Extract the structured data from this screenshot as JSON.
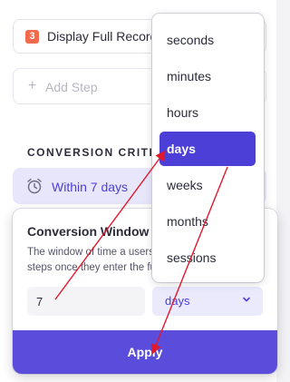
{
  "steps": {
    "step3": {
      "number": "3",
      "label": "Display Full Record"
    },
    "add_step_label": "Add Step",
    "add_step_icon": "plus-icon"
  },
  "conversion": {
    "heading": "CONVERSION CRITERIA",
    "summary_icon": "alarm-clock-icon",
    "summary_label": "Within 7 days"
  },
  "popover": {
    "title": "Conversion Window",
    "description": "The window of time a users has to complete all steps once they enter the funnel",
    "amount_value": "7",
    "unit_value": "days",
    "apply_label": "Apply"
  },
  "dropdown": {
    "options": [
      "seconds",
      "minutes",
      "hours",
      "days",
      "weeks",
      "months",
      "sessions"
    ],
    "selected_index": 3
  },
  "colors": {
    "accent": "#5b4ddb",
    "accent_dark": "#4b3fd8",
    "annotation": "#e0192c",
    "step_badge": "#f26a4b"
  }
}
